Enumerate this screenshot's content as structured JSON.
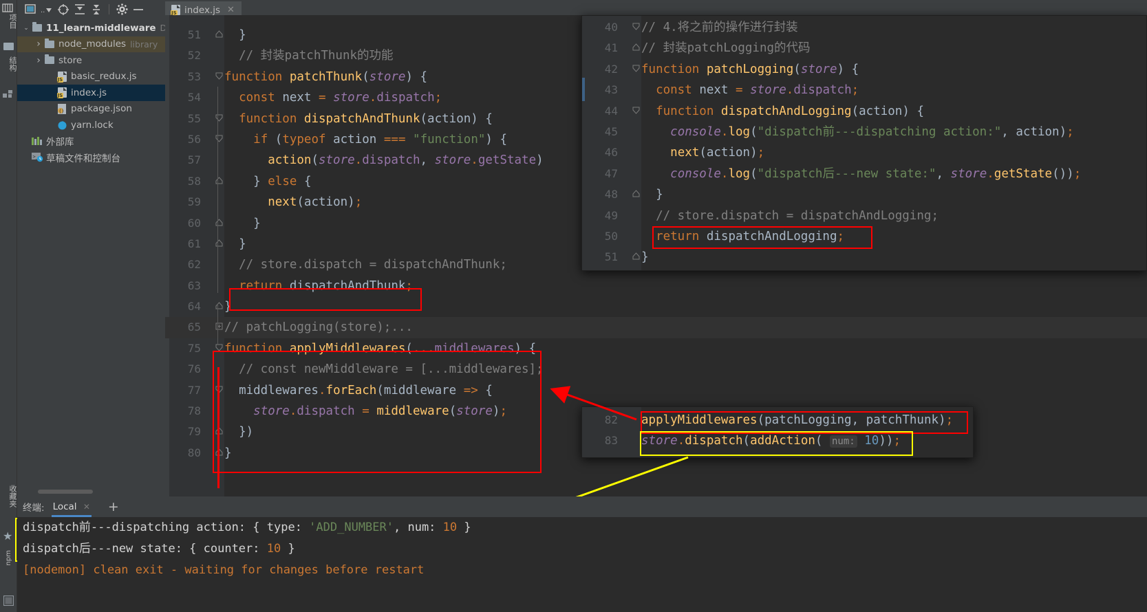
{
  "window": {
    "title": "index.js"
  },
  "toolstrip": {
    "project_label": "项目",
    "structure_label": "结构",
    "favorites_label": "收藏夹",
    "npm_label": "npm"
  },
  "project_toolbar": {
    "icons": [
      "window-icon",
      "dropdown-icon",
      "locate-icon",
      "expand-all-icon",
      "collapse-all-icon",
      "settings-icon",
      "minimize-icon"
    ]
  },
  "tree": [
    {
      "label": "11_learn-middleware",
      "sub": "D:",
      "indent": 0,
      "arrow": "▾",
      "icon": "folder-icon",
      "bold": true,
      "state": "normal"
    },
    {
      "label": "node_modules",
      "sub": "library",
      "indent": 1,
      "arrow": "›",
      "icon": "folder-icon",
      "bold": false,
      "state": "highlighted"
    },
    {
      "label": "store",
      "sub": "",
      "indent": 1,
      "arrow": "›",
      "icon": "folder-icon",
      "bold": false,
      "state": "normal"
    },
    {
      "label": "basic_redux.js",
      "sub": "",
      "indent": 2,
      "arrow": "",
      "icon": "js-file-icon",
      "bold": false,
      "state": "normal"
    },
    {
      "label": "index.js",
      "sub": "",
      "indent": 2,
      "arrow": "",
      "icon": "js-file-icon",
      "bold": false,
      "state": "selected"
    },
    {
      "label": "package.json",
      "sub": "",
      "indent": 2,
      "arrow": "",
      "icon": "json-file-icon",
      "bold": false,
      "state": "normal"
    },
    {
      "label": "yarn.lock",
      "sub": "",
      "indent": 2,
      "arrow": "",
      "icon": "yarn-icon",
      "bold": false,
      "state": "normal"
    },
    {
      "label": "外部库",
      "sub": "",
      "indent": 0,
      "arrow": "",
      "icon": "library-icon",
      "bold": false,
      "state": "normal"
    },
    {
      "label": "草稿文件和控制台",
      "sub": "",
      "indent": 0,
      "arrow": "",
      "icon": "scratch-icon",
      "bold": false,
      "state": "normal"
    }
  ],
  "tab": {
    "label": "index.js",
    "close": "✕",
    "icon": "js-file-icon"
  },
  "editor_lines": [
    {
      "num": "50",
      "fold": "",
      "text": "      return dispatchAndLogging;",
      "partial": true
    },
    {
      "num": "51",
      "fold": "minus",
      "text": "  }"
    },
    {
      "num": "52",
      "fold": "",
      "text": "  // 封装patchThunk的功能"
    },
    {
      "num": "53",
      "fold": "caret",
      "text": "function patchThunk(store) {"
    },
    {
      "num": "54",
      "fold": "",
      "text": "  const next = store.dispatch;"
    },
    {
      "num": "55",
      "fold": "caret",
      "text": "  function dispatchAndThunk(action) {"
    },
    {
      "num": "56",
      "fold": "caret",
      "text": "    if (typeof action === \"function\") {"
    },
    {
      "num": "57",
      "fold": "",
      "text": "      action(store.dispatch, store.getState)"
    },
    {
      "num": "58",
      "fold": "minus",
      "text": "    } else {"
    },
    {
      "num": "59",
      "fold": "",
      "text": "      next(action);"
    },
    {
      "num": "60",
      "fold": "minus",
      "text": "    }"
    },
    {
      "num": "61",
      "fold": "minus",
      "text": "  }"
    },
    {
      "num": "62",
      "fold": "",
      "text": "  // store.dispatch = dispatchAndThunk;"
    },
    {
      "num": "63",
      "fold": "",
      "text": "  return dispatchAndThunk;"
    },
    {
      "num": "64",
      "fold": "minus",
      "text": "}"
    },
    {
      "num": "65",
      "fold": "plus",
      "text": "// patchLogging(store);..."
    },
    {
      "num": "75",
      "fold": "caret",
      "text": "function applyMiddlewares(...middlewares) {"
    },
    {
      "num": "76",
      "fold": "",
      "text": "  // const newMiddleware = [...middlewares];"
    },
    {
      "num": "77",
      "fold": "caret",
      "text": "  middlewares.forEach(middleware => {"
    },
    {
      "num": "78",
      "fold": "",
      "text": "    store.dispatch = middleware(store);"
    },
    {
      "num": "79",
      "fold": "minus",
      "text": "  })"
    },
    {
      "num": "80",
      "fold": "minus",
      "text": "}"
    }
  ],
  "popup_top_lines": [
    {
      "num": "40",
      "fold": "caret",
      "text": "// 4.将之前的操作进行封装"
    },
    {
      "num": "41",
      "fold": "minus",
      "text": "// 封装patchLogging的代码"
    },
    {
      "num": "42",
      "fold": "caret",
      "text": "function patchLogging(store) {"
    },
    {
      "num": "43",
      "fold": "",
      "text": "  const next = store.dispatch;"
    },
    {
      "num": "44",
      "fold": "caret",
      "text": "  function dispatchAndLogging(action) {"
    },
    {
      "num": "45",
      "fold": "",
      "text": "    console.log(\"dispatch前---dispatching action:\", action);"
    },
    {
      "num": "46",
      "fold": "",
      "text": "    next(action);"
    },
    {
      "num": "47",
      "fold": "",
      "text": "    console.log(\"dispatch后---new state:\", store.getState());"
    },
    {
      "num": "48",
      "fold": "minus",
      "text": "  }"
    },
    {
      "num": "49",
      "fold": "",
      "text": "  // store.dispatch = dispatchAndLogging;"
    },
    {
      "num": "50",
      "fold": "",
      "text": "  return dispatchAndLogging;"
    },
    {
      "num": "51",
      "fold": "minus",
      "text": "}"
    }
  ],
  "popup_bottom_lines": [
    {
      "num": "82",
      "fold": "",
      "text": "applyMiddlewares(patchLogging, patchThunk);"
    },
    {
      "num": "83",
      "fold": "",
      "text": "store.dispatch(addAction( num: 10));"
    }
  ],
  "terminal": {
    "title": "终端:",
    "tab": "Local",
    "close": "✕",
    "add": "+",
    "lines": [
      "dispatch前---dispatching action: { type: 'ADD_NUMBER', num: 10 }",
      "dispatch后---new state: { counter: 10 }",
      "[nodemon] clean exit - waiting for changes before restart"
    ]
  },
  "annotations": {
    "red_boxes": 4,
    "yellow_boxes": 2,
    "red_arrow": "points from popup-bottom-line-82 to editor applyMiddlewares block",
    "yellow_arrow": "points from popup-bottom-line-83 to terminal output"
  },
  "colors": {
    "editor_bg": "#2b2b2b",
    "panel_bg": "#3c3f41",
    "gutter_bg": "#313335",
    "selection": "#0d293e",
    "highlight": "#4e4835",
    "accent": "#4a88c7",
    "keyword": "#cc7832",
    "function": "#ffc66d",
    "string": "#6a8759",
    "comment": "#808080",
    "number": "#6897bb",
    "field": "#9876aa",
    "text": "#a9b7c6",
    "annotation_red": "#ff0000",
    "annotation_yellow": "#ffff00"
  }
}
